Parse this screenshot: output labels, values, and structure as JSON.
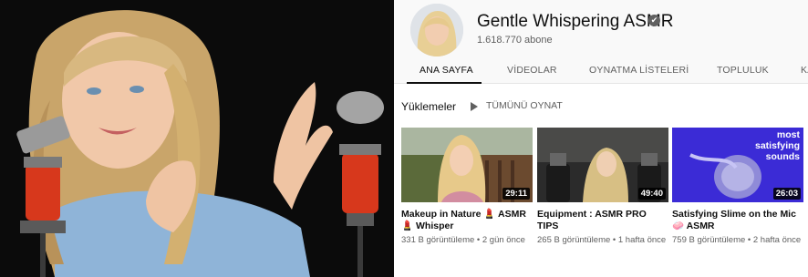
{
  "channel": {
    "name": "Gentle Whispering ASMR",
    "verified_glyph": "✔",
    "subscribers": "1.618.770 abone"
  },
  "tabs": [
    {
      "label": "ANA SAYFA",
      "active": true
    },
    {
      "label": "VİDEOLAR",
      "active": false
    },
    {
      "label": "OYNATMA LİSTELERİ",
      "active": false
    },
    {
      "label": "TOPLULUK",
      "active": false
    },
    {
      "label": "KA",
      "active": false
    }
  ],
  "uploads": {
    "title": "Yüklemeler",
    "play_all": "TÜMÜNÜ OYNAT",
    "videos": [
      {
        "title": "Makeup in Nature 💄 ASMR 💄 Whisper",
        "duration": "29:11",
        "meta": "331 B görüntüleme • 2 gün önce"
      },
      {
        "title": "Equipment : ASMR PRO TIPS",
        "duration": "49:40",
        "meta": "265 B görüntüleme • 1 hafta önce"
      },
      {
        "title": "Satisfying Slime on the Mic 🧼 ASMR",
        "duration": "26:03",
        "meta": "759 B görüntüleme • 2 hafta önce",
        "overlay_text": "most satisfying sounds"
      }
    ]
  },
  "colors": {
    "accent_red": "#d7381c",
    "text_secondary": "#606060",
    "thumb3_purple": "#3b2bd6"
  }
}
